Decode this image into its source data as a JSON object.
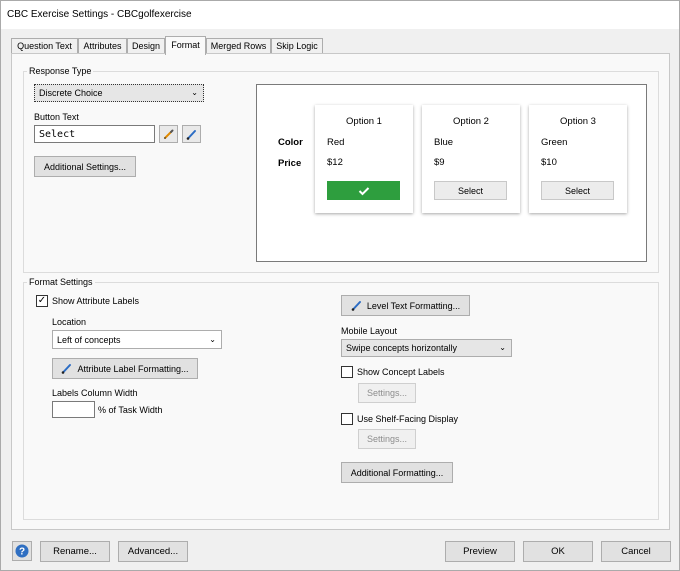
{
  "window": {
    "title": "CBC Exercise Settings - CBCgolfexercise"
  },
  "tabs": [
    {
      "label": "Question Text"
    },
    {
      "label": "Attributes"
    },
    {
      "label": "Design"
    },
    {
      "label": "Format"
    },
    {
      "label": "Merged Rows"
    },
    {
      "label": "Skip Logic"
    }
  ],
  "active_tab": "Format",
  "response_type": {
    "group_title": "Response Type",
    "selected": "Discrete Choice",
    "button_text_label": "Button Text",
    "button_text_value": "Select",
    "additional_settings_label": "Additional Settings..."
  },
  "preview": {
    "attribute_labels": [
      "Color",
      "Price"
    ],
    "concepts": [
      {
        "header": "Option 1",
        "color": "Red",
        "price": "$12",
        "selected": true,
        "button_label": ""
      },
      {
        "header": "Option 2",
        "color": "Blue",
        "price": "$9",
        "selected": false,
        "button_label": "Select"
      },
      {
        "header": "Option 3",
        "color": "Green",
        "price": "$10",
        "selected": false,
        "button_label": "Select"
      }
    ],
    "selected_color": "#2e9e3e"
  },
  "format_settings": {
    "group_title": "Format Settings",
    "show_attribute_labels": {
      "label": "Show Attribute Labels",
      "checked": true
    },
    "location_label": "Location",
    "location_value": "Left of concepts",
    "attribute_label_formatting": "Attribute Label Formatting...",
    "labels_column_width_label": "Labels Column Width",
    "labels_column_width_value": "",
    "task_width_suffix": "% of Task Width",
    "level_text_formatting": "Level Text Formatting...",
    "mobile_layout_label": "Mobile Layout",
    "mobile_layout_value": "Swipe concepts horizontally",
    "show_concept_labels": {
      "label": "Show Concept Labels",
      "checked": false
    },
    "settings_label": "Settings...",
    "shelf_facing": {
      "label": "Use Shelf-Facing Display",
      "checked": false
    },
    "additional_formatting": "Additional Formatting..."
  },
  "footer": {
    "help_icon": "question-icon",
    "rename": "Rename...",
    "advanced": "Advanced...",
    "preview": "Preview",
    "ok": "OK",
    "cancel": "Cancel"
  }
}
